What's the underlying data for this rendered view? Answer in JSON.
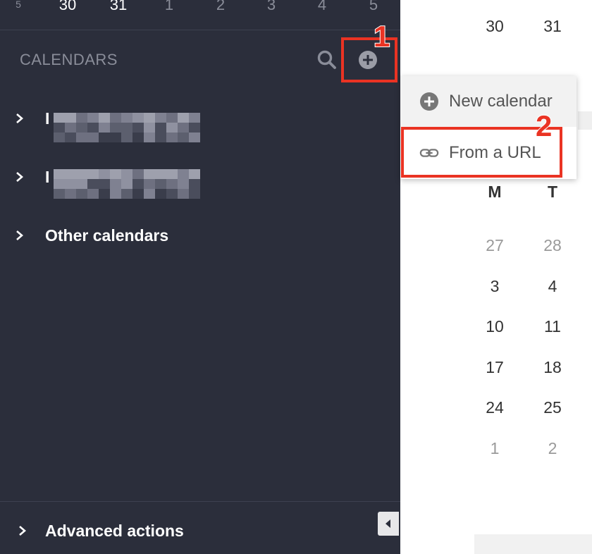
{
  "mini_calendar_strip": {
    "days": [
      "5",
      "30",
      "31",
      "1",
      "2",
      "3",
      "4",
      "5"
    ]
  },
  "sidebar": {
    "header": "CALENDARS",
    "calendars": [
      {
        "label": "I",
        "redacted": true
      },
      {
        "label": "I",
        "redacted": true
      },
      {
        "label": "Other calendars",
        "redacted": false
      }
    ],
    "advanced_label": "Advanced actions",
    "icons": {
      "search": "search-icon",
      "add": "plus-circle-icon",
      "chevron": "chevron-right-icon",
      "collapse": "caret-left-icon"
    }
  },
  "menu": {
    "items": [
      {
        "label": "New calendar",
        "icon": "plus-circle-icon"
      },
      {
        "label": "From a URL",
        "icon": "link-icon"
      }
    ]
  },
  "month": {
    "top_row": [
      "30",
      "31"
    ],
    "weekday_headers": [
      "M",
      "T"
    ],
    "weeks": [
      [
        "27",
        "28"
      ],
      [
        "3",
        "4"
      ],
      [
        "10",
        "11"
      ],
      [
        "17",
        "18"
      ],
      [
        "24",
        "25"
      ],
      [
        "1",
        "2"
      ]
    ]
  },
  "annotations": {
    "step1": "1",
    "step2": "2",
    "color": "#ea3323"
  },
  "colors": {
    "sidebar_bg": "#2b2e3b",
    "accent_red": "#ea3323"
  }
}
